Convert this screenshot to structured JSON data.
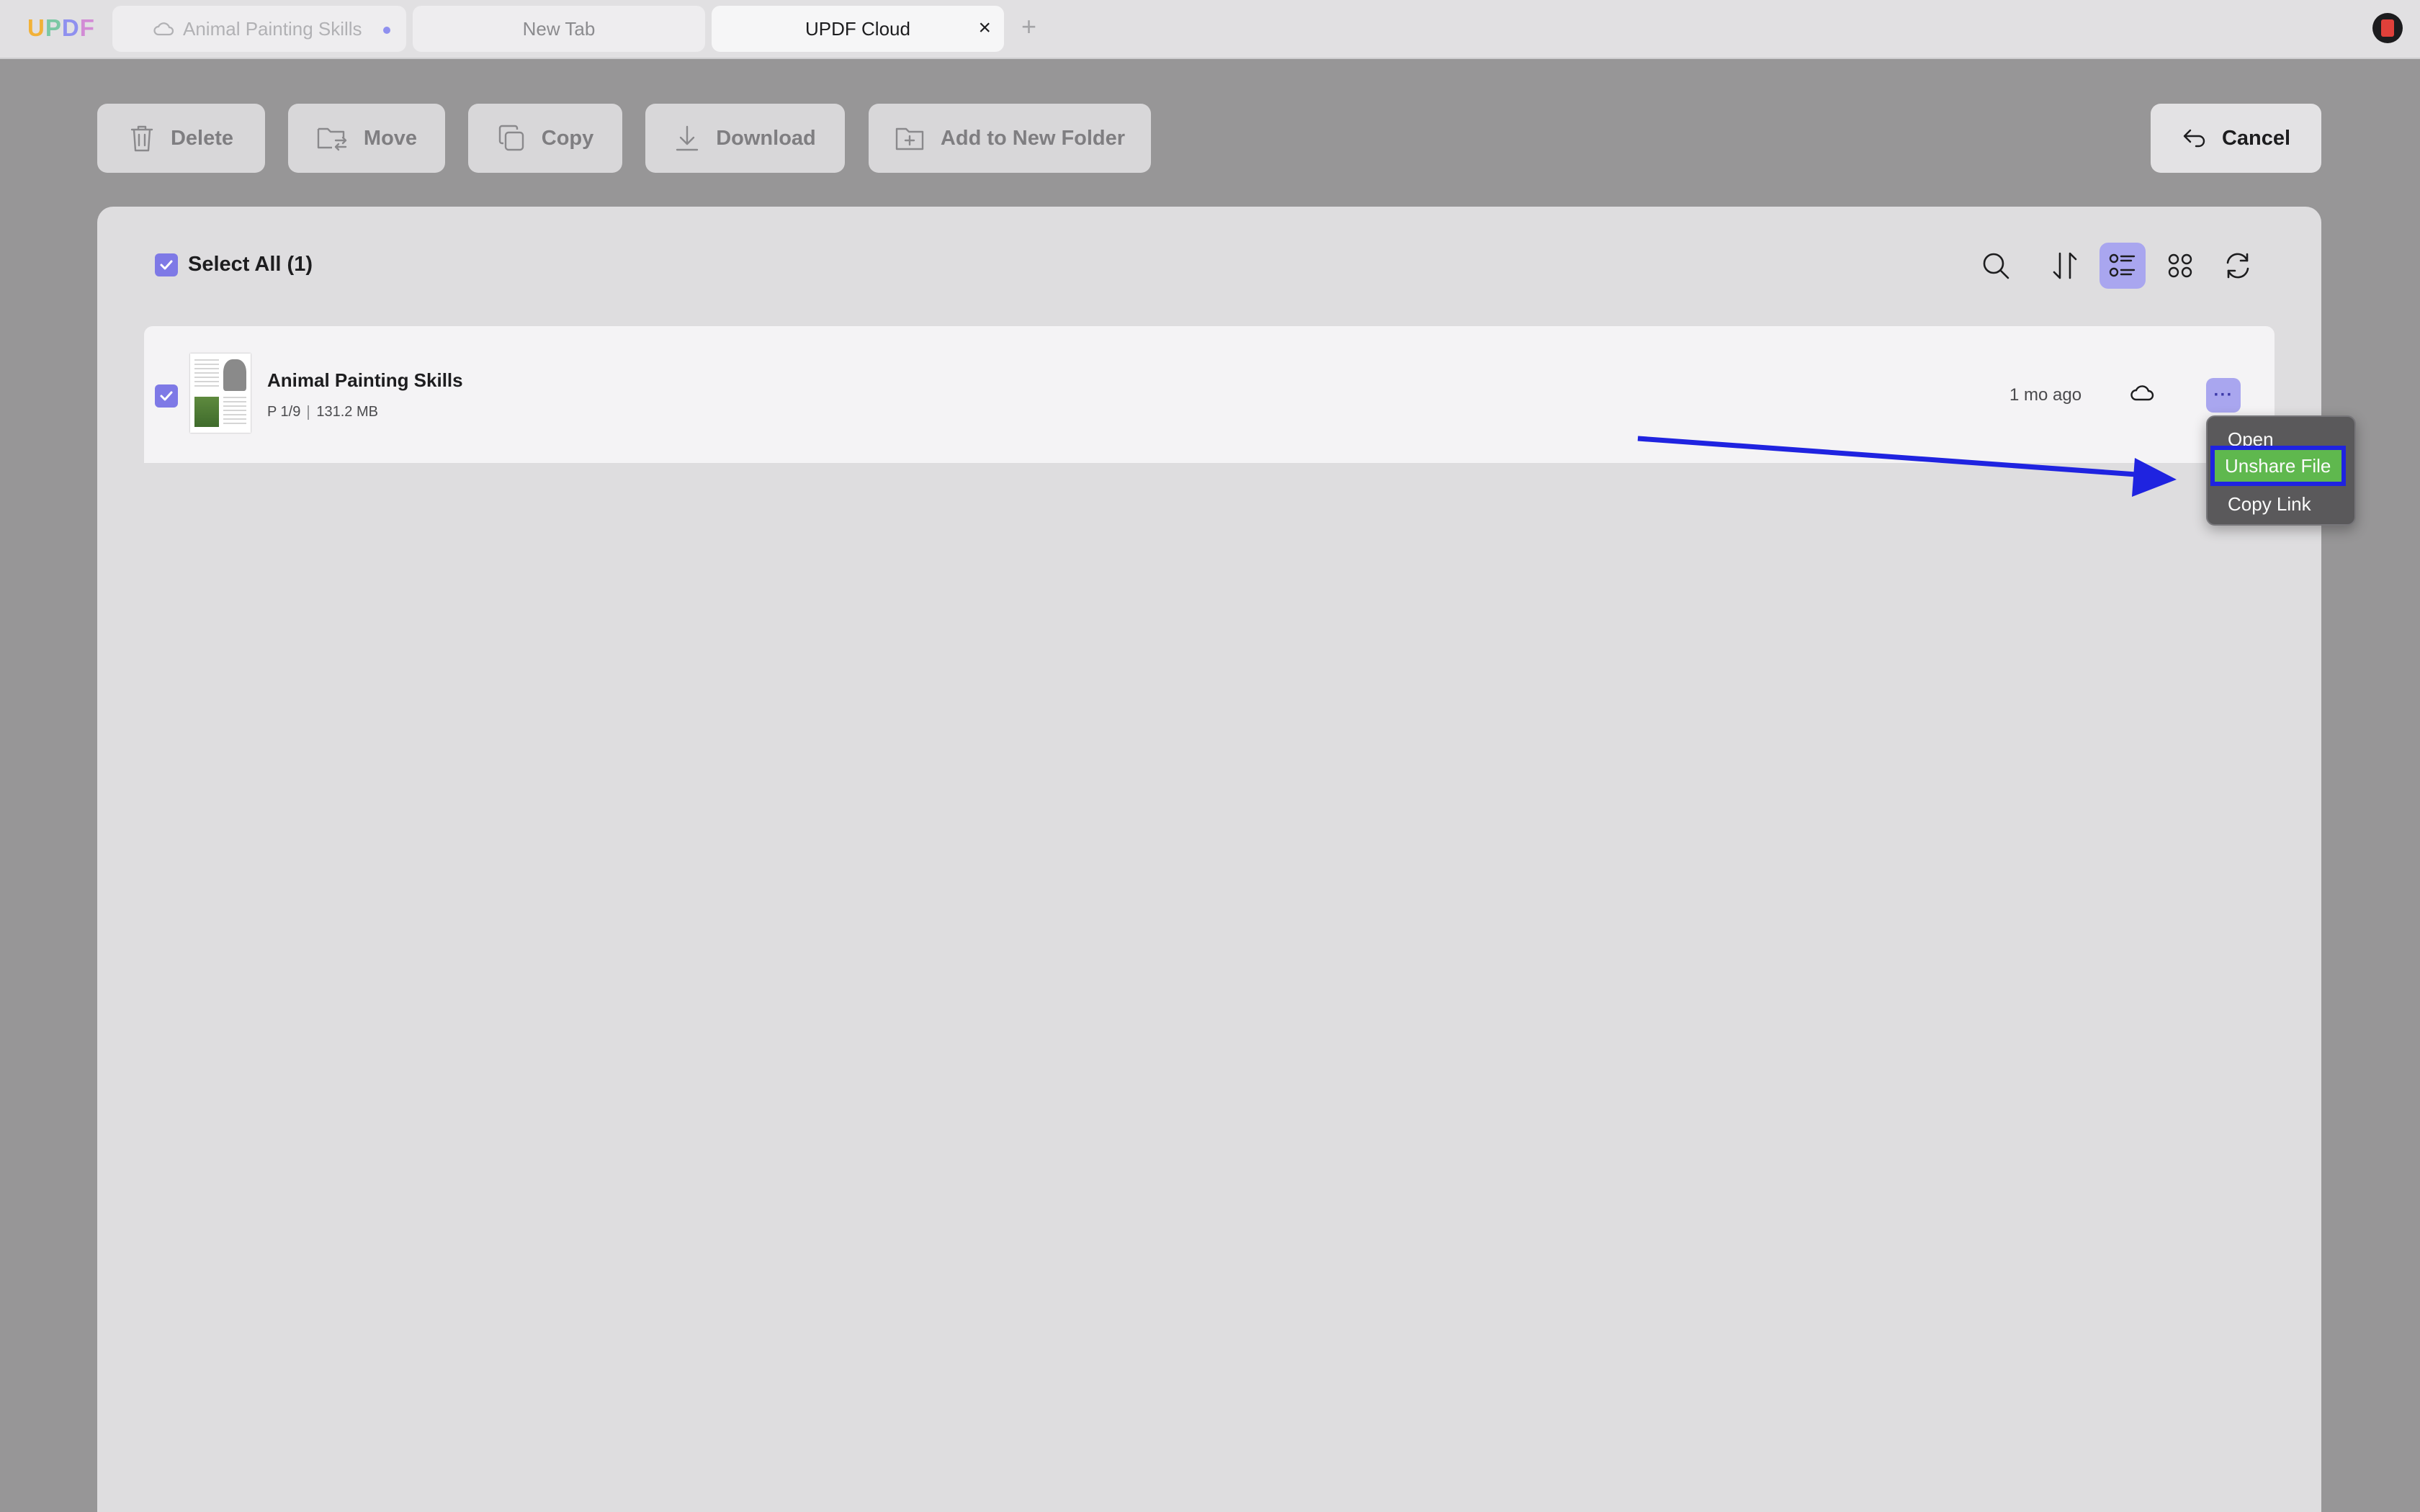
{
  "app": {
    "logo": [
      "U",
      "P",
      "D",
      "F"
    ]
  },
  "tabs": [
    {
      "label": "Animal Painting Skills",
      "unsaved": true
    },
    {
      "label": "New Tab"
    },
    {
      "label": "UPDF Cloud",
      "close": "×"
    }
  ],
  "new_tab_label": "+",
  "toolbar": {
    "delete_label": "Delete",
    "move_label": "Move",
    "copy_label": "Copy",
    "download_label": "Download",
    "add_folder_label": "Add to New Folder",
    "cancel_label": "Cancel"
  },
  "list": {
    "select_all_label": "Select All (1)",
    "view_mode": "list",
    "files": [
      {
        "name": "Animal Painting Skills",
        "pages": "P 1/9",
        "size": "131.2 MB",
        "modified": "1 mo ago",
        "checked": true
      }
    ]
  },
  "menu": {
    "items": [
      "Open",
      "Unshare File",
      "Copy Link"
    ],
    "highlighted": "Unshare File"
  },
  "colors": {
    "accent": "#7e79e6",
    "accent_light": "#a9a6ef",
    "highlight_green": "#5fb84e",
    "annotation_blue": "#1f23e0"
  }
}
